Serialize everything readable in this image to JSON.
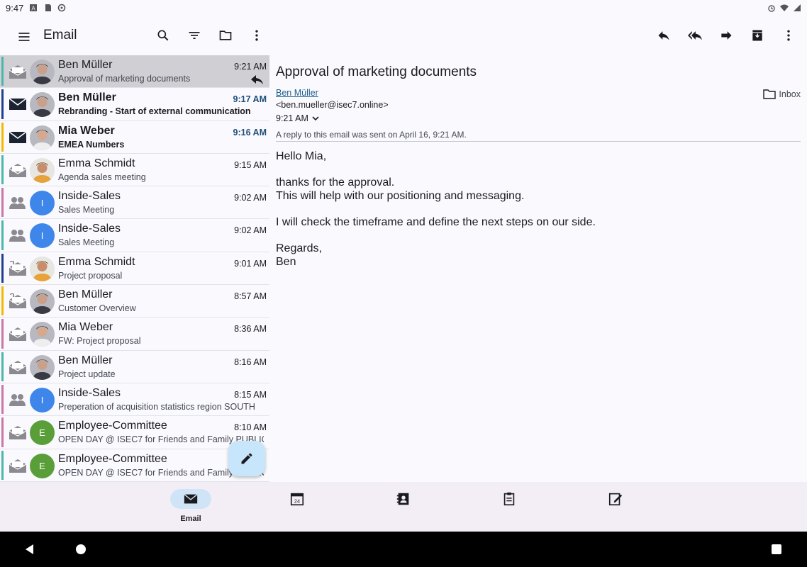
{
  "status": {
    "time": "9:47"
  },
  "appbar": {
    "title": "Email",
    "icons": [
      "menu-icon",
      "search-icon",
      "filter-icon",
      "folder-icon",
      "more-icon"
    ]
  },
  "detail_toolbar": {
    "icons": [
      "reply-icon",
      "reply-all-icon",
      "forward-icon",
      "archive-icon",
      "more-icon"
    ]
  },
  "colors": {
    "teal": "#4db6ac",
    "navy": "#1f3f8f",
    "amber": "#f5b800",
    "pink": "#c977a6",
    "blue_avatar": "#3f86ea",
    "green_avatar": "#5a9e3a",
    "selected": "#cfcfd4"
  },
  "messages": [
    {
      "name": "Ben Müller",
      "subject": "Approval of marketing documents",
      "time": "9:21 AM",
      "bar": "#4db6ac",
      "env": "open",
      "avatar": "ben",
      "unread": false,
      "selected": true,
      "replied": true
    },
    {
      "name": "Ben Müller",
      "subject": "Rebranding - Start of external communication",
      "time": "9:17 AM",
      "bar": "#1f3f8f",
      "env": "closed",
      "avatar": "ben",
      "unread": true
    },
    {
      "name": "Mia Weber",
      "subject": "EMEA Numbers",
      "time": "9:16 AM",
      "bar": "#f5b800",
      "env": "closed",
      "avatar": "mia",
      "unread": true
    },
    {
      "name": "Emma Schmidt",
      "subject": "Agenda sales meeting",
      "time": "9:15 AM",
      "bar": "#4db6ac",
      "env": "open",
      "avatar": "emma",
      "unread": false
    },
    {
      "name": "Inside-Sales",
      "subject": "Sales Meeting",
      "time": "9:02 AM",
      "bar": "#c977a6",
      "env": "group",
      "avatar": "letter",
      "letter": "I",
      "avatar_color": "#3f86ea",
      "unread": false
    },
    {
      "name": "Inside-Sales",
      "subject": "Sales Meeting",
      "time": "9:02 AM",
      "bar": "#4db6ac",
      "env": "group",
      "avatar": "letter",
      "letter": "I",
      "avatar_color": "#3f86ea",
      "unread": false
    },
    {
      "name": "Emma Schmidt",
      "subject": "Project proposal",
      "time": "9:01 AM",
      "bar": "#1f3f8f",
      "env": "attach",
      "avatar": "emma",
      "unread": false
    },
    {
      "name": "Ben Müller",
      "subject": "Customer Overview",
      "time": "8:57 AM",
      "bar": "#f5b800",
      "env": "attach",
      "avatar": "ben",
      "unread": false
    },
    {
      "name": "Mia Weber",
      "subject": "FW: Project proposal",
      "time": "8:36 AM",
      "bar": "#c977a6",
      "env": "open",
      "avatar": "mia",
      "unread": false
    },
    {
      "name": "Ben Müller",
      "subject": "Project update",
      "time": "8:16 AM",
      "bar": "#4db6ac",
      "env": "open",
      "avatar": "ben",
      "unread": false
    },
    {
      "name": "Inside-Sales",
      "subject": "Preperation of acquisition statistics region SOUTH",
      "time": "8:15 AM",
      "bar": "#c977a6",
      "env": "group",
      "avatar": "letter",
      "letter": "I",
      "avatar_color": "#3f86ea",
      "unread": false
    },
    {
      "name": "Employee-Committee",
      "subject": "OPEN DAY @ ISEC7 for Friends and Family PUBLIC",
      "time": "8:10 AM",
      "bar": "#c977a6",
      "env": "open",
      "avatar": "letter",
      "letter": "E",
      "avatar_color": "#5a9e3a",
      "unread": false
    },
    {
      "name": "Employee-Committee",
      "subject": "OPEN DAY @ ISEC7 for Friends and Family PUBLIC",
      "time": "",
      "bar": "#4db6ac",
      "env": "open",
      "avatar": "letter",
      "letter": "E",
      "avatar_color": "#5a9e3a",
      "unread": false
    }
  ],
  "detail": {
    "subject": "Approval of marketing documents",
    "sender": "Ben Müller",
    "email": "<ben.mueller@isec7.online>",
    "time": "9:21 AM",
    "folder": "Inbox",
    "note": "A reply to this email was sent on April 16, 9:21 AM.",
    "body": [
      [
        "Hello Mia,"
      ],
      [
        "thanks for the approval.",
        "This will help with our positioning and messaging."
      ],
      [
        "I will check the timeframe and define the next steps on our side."
      ],
      [
        "Regards,",
        "Ben"
      ]
    ]
  },
  "bottomnav": [
    {
      "id": "email",
      "label": "Email",
      "icon": "mail-icon",
      "active": true
    },
    {
      "id": "calendar",
      "label": "",
      "icon": "calendar-icon",
      "active": false
    },
    {
      "id": "contacts",
      "label": "",
      "icon": "contacts-icon",
      "active": false
    },
    {
      "id": "tasks",
      "label": "",
      "icon": "tasks-icon",
      "active": false
    },
    {
      "id": "notes",
      "label": "",
      "icon": "notes-icon",
      "active": false
    }
  ]
}
